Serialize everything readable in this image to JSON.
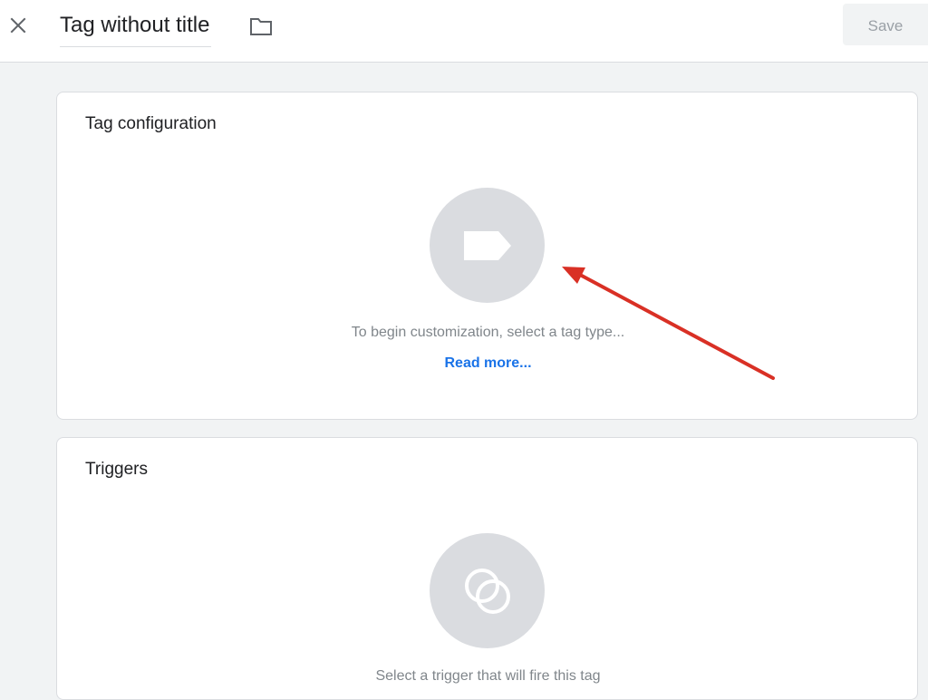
{
  "header": {
    "title": "Tag without title",
    "save_label": "Save"
  },
  "tag_configuration": {
    "title": "Tag configuration",
    "hint": "To begin customization, select a tag type...",
    "read_more": "Read more...",
    "icon": "tag-icon"
  },
  "triggers": {
    "title": "Triggers",
    "hint": "Select a trigger that will fire this tag",
    "icon": "trigger-icon"
  },
  "annotation": {
    "arrow_color": "#d93025"
  },
  "colors": {
    "link": "#1a73e8",
    "placeholder_circle": "#dadce0",
    "background": "#f1f3f4"
  }
}
